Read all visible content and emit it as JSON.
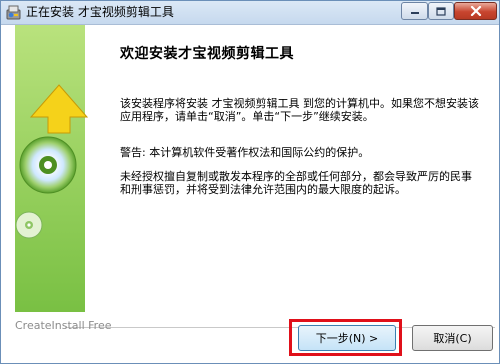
{
  "window": {
    "title": "正在安装 才宝视频剪辑工具"
  },
  "content": {
    "heading": "欢迎安装才宝视频剪辑工具",
    "paragraph_1": "该安装程序将安装 才宝视频剪辑工具 到您的计算机中。如果您不想安装该应用程序，请单击“取消”。单击“下一步”继续安装。",
    "paragraph_2": "警告: 本计算机软件受著作权法和国际公约的保护。",
    "paragraph_3": "未经授权擅自复制或散发本程序的全部或任何部分，都会导致严厉的民事和刑事惩罚，并将受到法律允许范围内的最大限度的起诉。"
  },
  "footer": {
    "brand": "CreateInstall Free",
    "next_label": "下一步(N) >",
    "cancel_label": "取消(C)"
  },
  "colors": {
    "banner_green": "#7cc242",
    "arrow_yellow": "#f5d21a",
    "highlight_red": "#e0101a"
  },
  "icons": [
    "installer-app-icon",
    "minimize-icon",
    "maximize-icon",
    "close-icon",
    "cd-disc-icon",
    "up-arrow-icon"
  ]
}
